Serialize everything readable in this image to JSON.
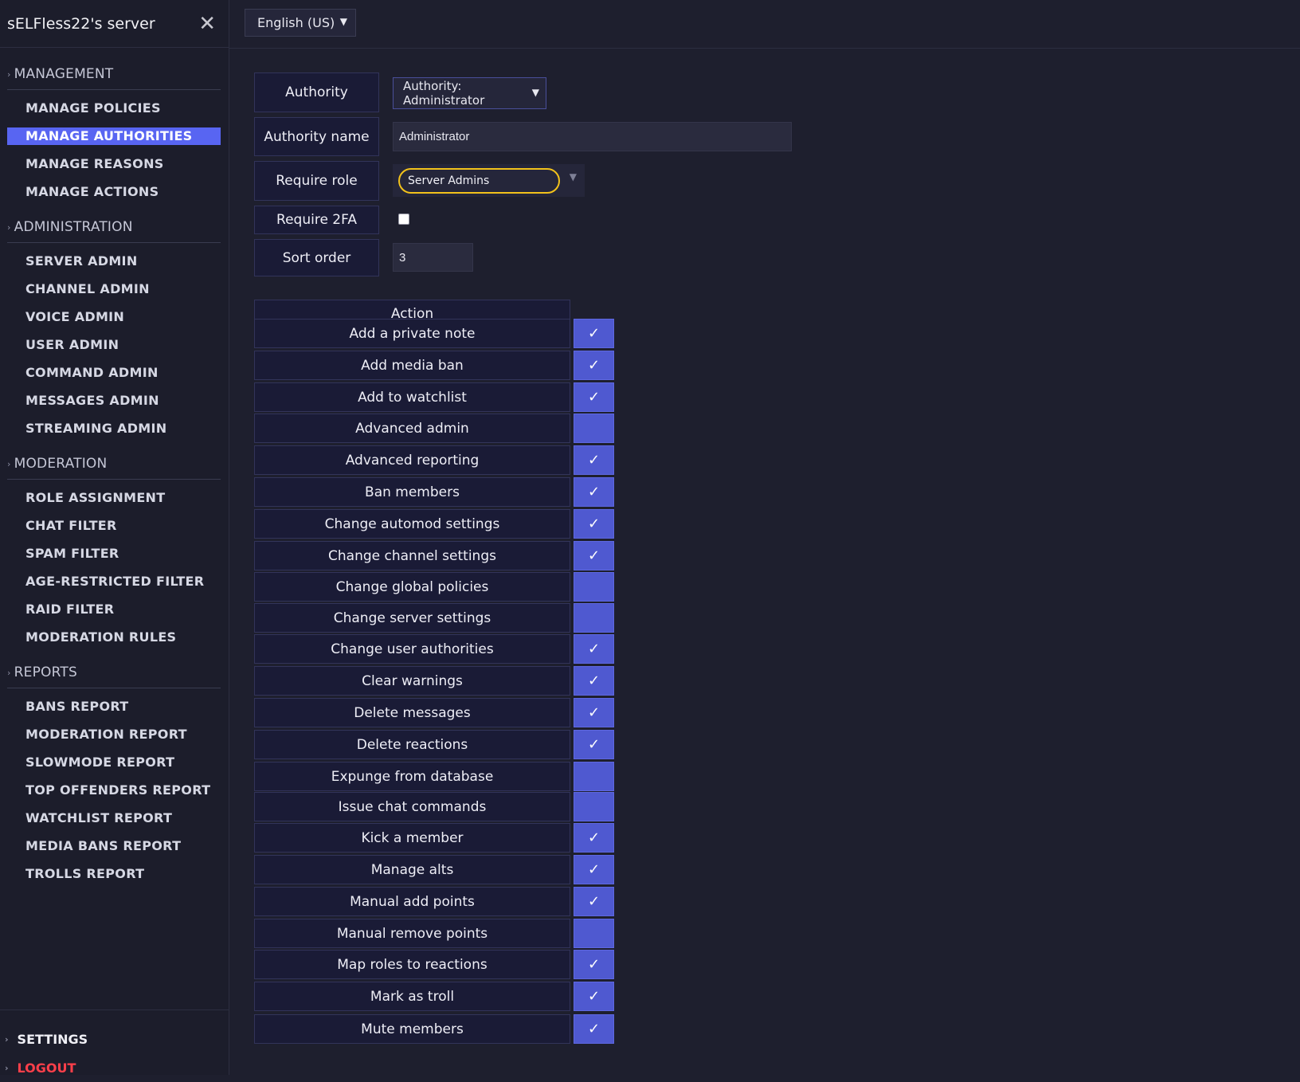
{
  "sidebar": {
    "server_name": "sELFless22's server",
    "close_icon": "close-icon",
    "sections": [
      {
        "title": "MANAGEMENT",
        "items": [
          "MANAGE POLICIES",
          "MANAGE AUTHORITIES",
          "MANAGE REASONS",
          "MANAGE ACTIONS"
        ]
      },
      {
        "title": "ADMINISTRATION",
        "items": [
          "SERVER ADMIN",
          "CHANNEL ADMIN",
          "VOICE ADMIN",
          "USER ADMIN",
          "COMMAND ADMIN",
          "MESSAGES ADMIN",
          "STREAMING ADMIN"
        ]
      },
      {
        "title": "MODERATION",
        "items": [
          "ROLE ASSIGNMENT",
          "CHAT FILTER",
          "SPAM FILTER",
          "AGE-RESTRICTED FILTER",
          "RAID FILTER",
          "MODERATION RULES"
        ]
      },
      {
        "title": "REPORTS",
        "items": [
          "BANS REPORT",
          "MODERATION REPORT",
          "SLOWMODE REPORT",
          "TOP OFFENDERS REPORT",
          "WATCHLIST REPORT",
          "MEDIA BANS REPORT",
          "TROLLS REPORT"
        ]
      }
    ],
    "active_item": "MANAGE AUTHORITIES",
    "settings_label": "SETTINGS",
    "logout_label": "LOGOUT"
  },
  "topbar": {
    "language": "English (US)"
  },
  "form": {
    "authority_label": "Authority",
    "authority_value": "Authority: Administrator",
    "authority_name_label": "Authority name",
    "authority_name_value": "Administrator",
    "require_role_label": "Require role",
    "require_role_value": "Server Admins",
    "require_2fa_label": "Require 2FA",
    "require_2fa_checked": false,
    "sort_order_label": "Sort order",
    "sort_order_value": "3"
  },
  "actions": {
    "header": "Action",
    "check_glyph": "✓",
    "rows": [
      {
        "name": "Add a private note",
        "checked": true
      },
      {
        "name": "Add media ban",
        "checked": true
      },
      {
        "name": "Add to watchlist",
        "checked": true
      },
      {
        "name": "Advanced admin",
        "checked": false
      },
      {
        "name": "Advanced reporting",
        "checked": true
      },
      {
        "name": "Ban members",
        "checked": true
      },
      {
        "name": "Change automod settings",
        "checked": true
      },
      {
        "name": "Change channel settings",
        "checked": true
      },
      {
        "name": "Change global policies",
        "checked": false
      },
      {
        "name": "Change server settings",
        "checked": false
      },
      {
        "name": "Change user authorities",
        "checked": true
      },
      {
        "name": "Clear warnings",
        "checked": true
      },
      {
        "name": "Delete messages",
        "checked": true
      },
      {
        "name": "Delete reactions",
        "checked": true
      },
      {
        "name": "Expunge from database",
        "checked": false
      },
      {
        "name": "Issue chat commands",
        "checked": false
      },
      {
        "name": "Kick a member",
        "checked": true
      },
      {
        "name": "Manage alts",
        "checked": true
      },
      {
        "name": "Manual add points",
        "checked": true
      },
      {
        "name": "Manual remove points",
        "checked": false
      },
      {
        "name": "Map roles to reactions",
        "checked": true
      },
      {
        "name": "Mark as troll",
        "checked": true
      },
      {
        "name": "Mute members",
        "checked": true
      }
    ]
  },
  "colors": {
    "accent": "#5865f2",
    "checkbox_fill": "#4f59d0",
    "role_outline": "#f2c21b",
    "logout": "#ff3f4a"
  }
}
